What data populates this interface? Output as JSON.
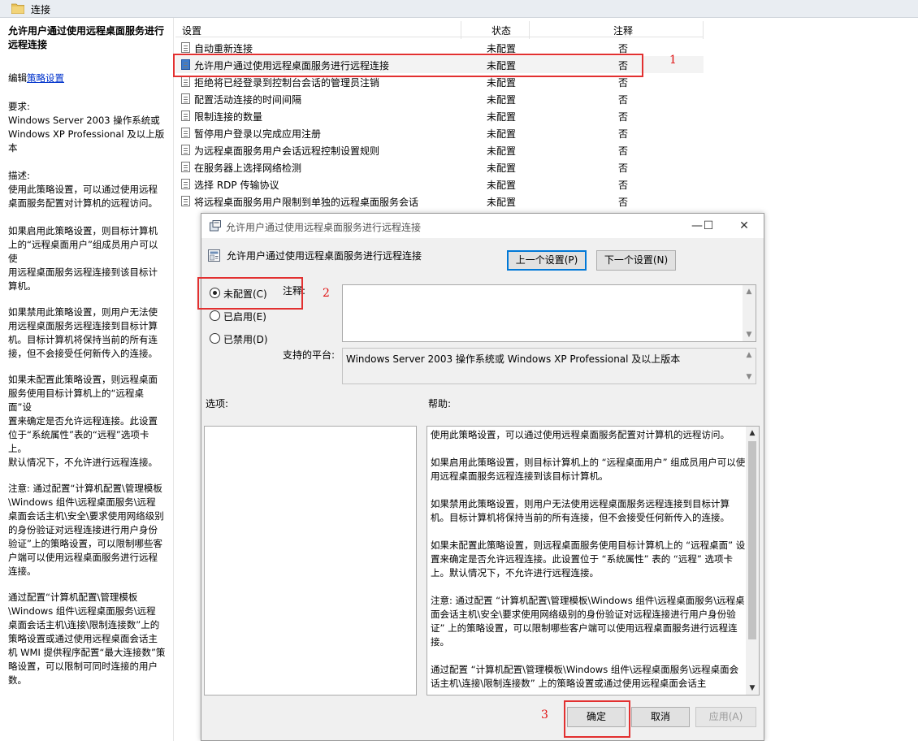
{
  "breadcrumb": {
    "title": "连接"
  },
  "left_pane": {
    "title": "允许用户通过使用远程桌面服务进行远程连接",
    "edit_prefix": "编辑",
    "edit_link": "策略设置",
    "requirements_label": "要求:",
    "requirements_text": "Windows Server 2003 操作系统或\nWindows XP Professional 及以上版\n本",
    "description_label": "描述:",
    "description_text": "使用此策略设置，可以通过使用远程\n桌面服务配置对计算机的远程访问。",
    "p_enabled": "如果启用此策略设置，则目标计算机\n上的“远程桌面用户”组成员用户可以使\n用远程桌面服务远程连接到该目标计\n算机。",
    "p_disabled": "如果禁用此策略设置，则用户无法使\n用远程桌面服务远程连接到目标计算\n机。目标计算机将保持当前的所有连\n接，但不会接受任何新传入的连接。",
    "p_notconfigured": "如果未配置此策略设置，则远程桌面\n服务使用目标计算机上的“远程桌面”设\n置来确定是否允许远程连接。此设置\n位于“系统属性”表的“远程”选项卡上。\n默认情况下，不允许进行远程连接。",
    "p_note": "注意: 通过配置“计算机配置\\管理模板\n\\Windows 组件\\远程桌面服务\\远程\n桌面会话主机\\安全\\要求使用网络级别\n的身份验证对远程连接进行用户身份\n验证”上的策略设置，可以限制哪些客\n户端可以使用远程桌面服务进行远程\n连接。",
    "p_limit": "通过配置“计算机配置\\管理模板\n\\Windows 组件\\远程桌面服务\\远程\n桌面会话主机\\连接\\限制连接数”上的\n策略设置或通过使用远程桌面会话主\n机 WMI 提供程序配置“最大连接数”策\n略设置，可以限制可同时连接的用户\n数。"
  },
  "list": {
    "columns": {
      "setting": "设置",
      "state": "状态",
      "note": "注释"
    },
    "rows": [
      {
        "name": "自动重新连接",
        "state": "未配置",
        "note": "否"
      },
      {
        "name": "允许用户通过使用远程桌面服务进行远程连接",
        "state": "未配置",
        "note": "否"
      },
      {
        "name": "拒绝将已经登录到控制台会话的管理员注销",
        "state": "未配置",
        "note": "否"
      },
      {
        "name": "配置活动连接的时间间隔",
        "state": "未配置",
        "note": "否"
      },
      {
        "name": "限制连接的数量",
        "state": "未配置",
        "note": "否"
      },
      {
        "name": "暂停用户登录以完成应用注册",
        "state": "未配置",
        "note": "否"
      },
      {
        "name": "为远程桌面服务用户会话远程控制设置规则",
        "state": "未配置",
        "note": "否"
      },
      {
        "name": "在服务器上选择网络检测",
        "state": "未配置",
        "note": "否"
      },
      {
        "name": "选择 RDP 传输协议",
        "state": "未配置",
        "note": "否"
      },
      {
        "name": "将远程桌面服务用户限制到单独的远程桌面服务会话",
        "state": "未配置",
        "note": "否"
      }
    ]
  },
  "annotations": {
    "n1": "1",
    "n2": "2",
    "n3": "3"
  },
  "dialog": {
    "window_title": "允许用户通过使用远程桌面服务进行远程连接",
    "heading": "允许用户通过使用远程桌面服务进行远程连接",
    "prev_button": "上一个设置(P)",
    "next_button": "下一个设置(N)",
    "radio_not_configured": "未配置(C)",
    "radio_enabled": "已启用(E)",
    "radio_disabled": "已禁用(D)",
    "comment_label": "注释:",
    "platform_label": "支持的平台:",
    "platform_value": "Windows Server 2003 操作系统或 Windows XP Professional 及以上版本",
    "options_label": "选项:",
    "help_label": "帮助:",
    "help_paragraphs": [
      "使用此策略设置，可以通过使用远程桌面服务配置对计算机的远程访问。",
      "如果启用此策略设置，则目标计算机上的 “远程桌面用户” 组成员用户可以使用远程桌面服务远程连接到该目标计算机。",
      "如果禁用此策略设置，则用户无法使用远程桌面服务远程连接到目标计算机。目标计算机将保持当前的所有连接，但不会接受任何新传入的连接。",
      "如果未配置此策略设置，则远程桌面服务使用目标计算机上的 “远程桌面” 设置来确定是否允许远程连接。此设置位于 “系统属性” 表的 “远程” 选项卡上。默认情况下，不允许进行远程连接。",
      "注意: 通过配置 “计算机配置\\管理模板\\Windows 组件\\远程桌面服务\\远程桌面会话主机\\安全\\要求使用网络级别的身份验证对远程连接进行用户身份验证” 上的策略设置，可以限制哪些客户端可以使用远程桌面服务进行远程连接。",
      "通过配置 “计算机配置\\管理模板\\Windows 组件\\远程桌面服务\\远程桌面会话主机\\连接\\限制连接数” 上的策略设置或通过使用远程桌面会话主"
    ],
    "ok_button": "确定",
    "cancel_button": "取消",
    "apply_button": "应用(A)",
    "minimize": "—",
    "maximize": "☐",
    "close": "✕"
  }
}
